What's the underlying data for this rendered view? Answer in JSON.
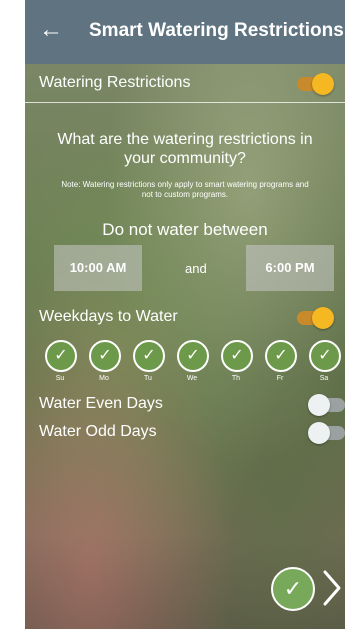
{
  "header": {
    "title": "Smart Watering Restrictions",
    "back_icon": "arrow-left-icon"
  },
  "watering_restrictions": {
    "label": "Watering Restrictions",
    "enabled": true
  },
  "question": "What are the watering restrictions in your community?",
  "note": "Note: Watering restrictions only apply to smart watering programs and not to custom programs.",
  "time_section": {
    "heading": "Do not water between",
    "start": "10:00 AM",
    "and_label": "and",
    "end": "6:00 PM"
  },
  "weekdays": {
    "label": "Weekdays to Water",
    "enabled": true,
    "days": [
      {
        "label": "Su"
      },
      {
        "label": "Mo"
      },
      {
        "label": "Tu"
      },
      {
        "label": "We"
      },
      {
        "label": "Th"
      },
      {
        "label": "Fr"
      },
      {
        "label": "Sa"
      }
    ]
  },
  "even_days": {
    "label": "Water Even Days",
    "enabled": false
  },
  "odd_days": {
    "label": "Water Odd Days",
    "enabled": false
  },
  "footer": {
    "confirm_icon": "check-icon",
    "next_icon": "chevron-right-icon"
  },
  "colors": {
    "accent": "#f5b822",
    "header": "#5f7380",
    "check": "#6d9a4a"
  }
}
